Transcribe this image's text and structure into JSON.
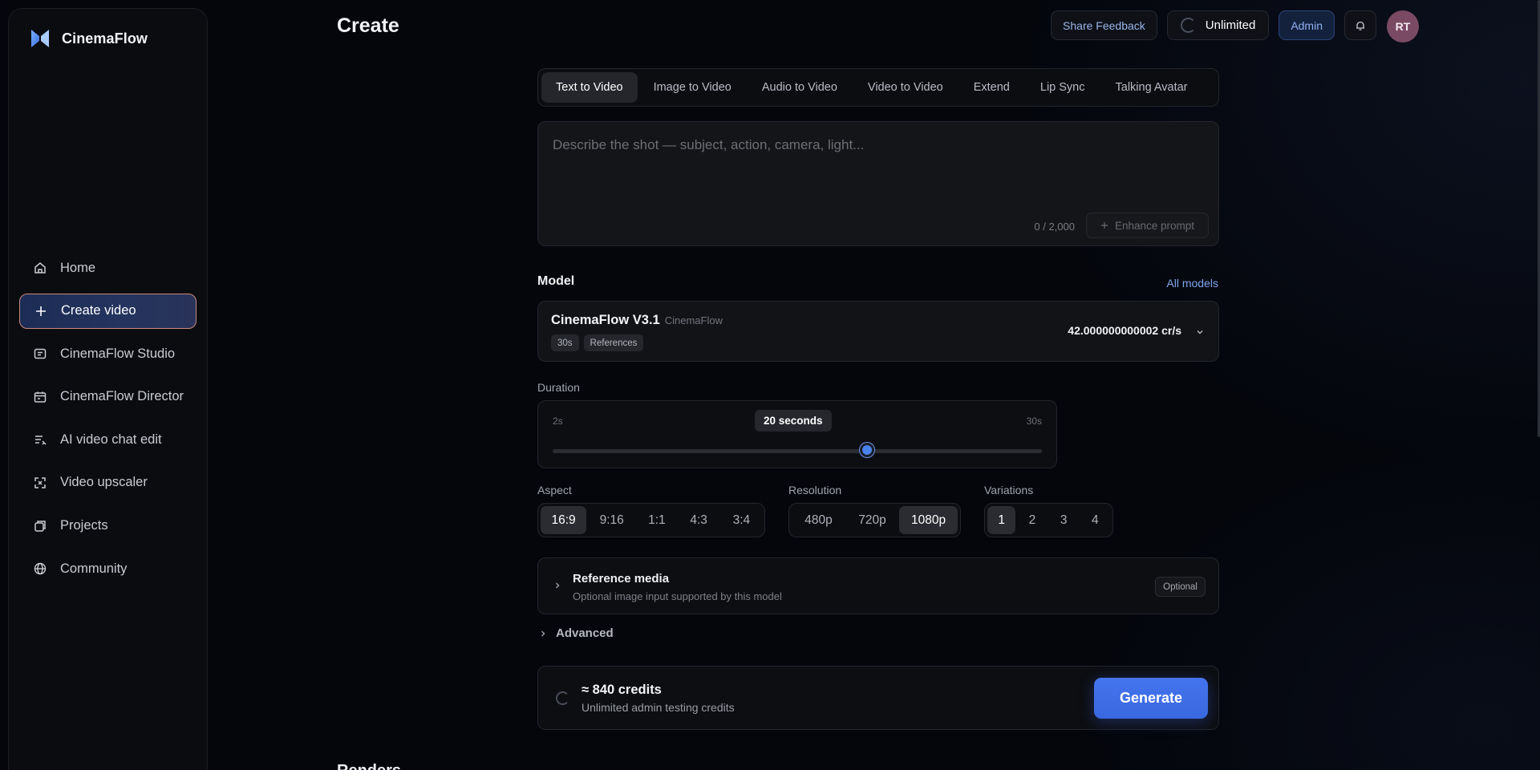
{
  "app": {
    "name": "CinemaFlow",
    "logo_icon": "cinemaflow-logo-icon"
  },
  "sidebar": {
    "items": [
      {
        "label": "Home",
        "icon": "home-icon"
      },
      {
        "label": "Create video",
        "icon": "plus-icon",
        "active": true
      },
      {
        "label": "CinemaFlow Studio",
        "icon": "studio-icon"
      },
      {
        "label": "CinemaFlow Director",
        "icon": "director-icon"
      },
      {
        "label": "AI video chat edit",
        "icon": "chat-edit-icon"
      },
      {
        "label": "Video upscaler",
        "icon": "expand-icon"
      },
      {
        "label": "Projects",
        "icon": "projects-icon"
      },
      {
        "label": "Community",
        "icon": "globe-icon"
      }
    ]
  },
  "header": {
    "title": "Create",
    "share_feedback": "Share Feedback",
    "plan": "Unlimited",
    "admin": "Admin",
    "avatar_initials": "RT"
  },
  "tabs": [
    "Text to Video",
    "Image to Video",
    "Audio to Video",
    "Video to Video",
    "Extend",
    "Lip Sync",
    "Talking Avatar"
  ],
  "active_tab": 0,
  "prompt": {
    "value": "",
    "placeholder": "Describe the shot — subject, action, camera, light...",
    "char_count": "0 / 2,000",
    "enhance_label": "Enhance prompt"
  },
  "model_section": {
    "title": "Model",
    "all_models": "All models",
    "name": "CinemaFlow V3.1",
    "vendor": "CinemaFlow",
    "chips": [
      "30s",
      "References"
    ],
    "rate": "42.000000000002 cr/s"
  },
  "duration": {
    "label": "Duration",
    "min_label": "2s",
    "max_label": "30s",
    "value_label": "20 seconds",
    "min": 2,
    "max": 30,
    "value": 20
  },
  "aspect": {
    "label": "Aspect",
    "options": [
      "16:9",
      "9:16",
      "1:1",
      "4:3",
      "3:4"
    ],
    "selected": "16:9"
  },
  "resolution": {
    "label": "Resolution",
    "options": [
      "480p",
      "720p",
      "1080p"
    ],
    "selected": "1080p"
  },
  "variations": {
    "label": "Variations",
    "options": [
      "1",
      "2",
      "3",
      "4"
    ],
    "selected": "1"
  },
  "reference": {
    "title": "Reference media",
    "subtitle": "Optional image input supported by this model",
    "badge": "Optional"
  },
  "advanced": {
    "label": "Advanced"
  },
  "credits": {
    "title": "≈ 840 credits",
    "subtitle": "Unlimited admin testing credits",
    "generate": "Generate"
  },
  "renders": {
    "title": "Renders"
  },
  "colors": {
    "accent": "#4474ee",
    "active_border": "#c98a7e",
    "link": "#7fa6ee"
  }
}
